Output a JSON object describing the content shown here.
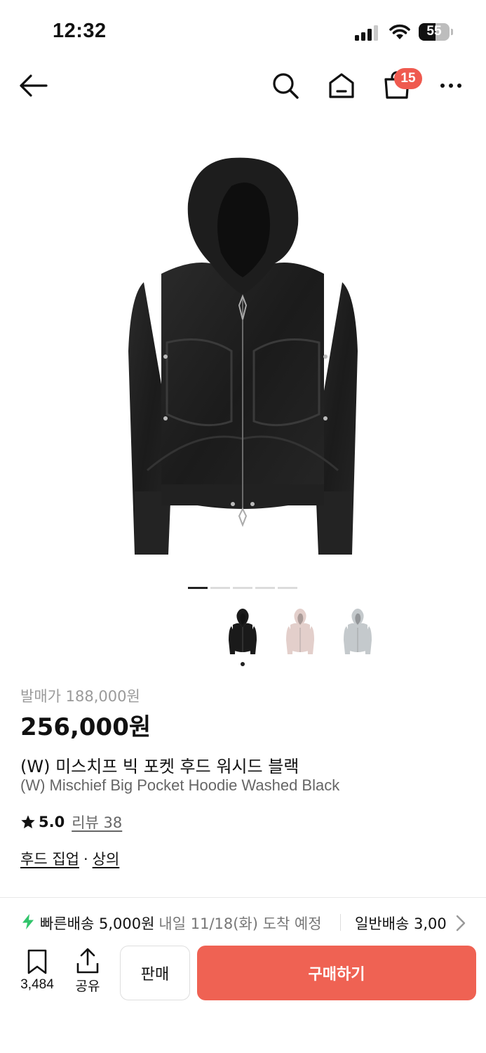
{
  "status_bar": {
    "time": "12:32",
    "battery": "55",
    "battery_level": 0.55
  },
  "nav": {
    "cart_count": "15"
  },
  "gallery": {
    "page_count": 5,
    "active_page": 0,
    "thumbnails": [
      {
        "color": "#1a1a1a",
        "name": "black"
      },
      {
        "color": "#e3cfcb",
        "name": "pink"
      },
      {
        "color": "#c4c9cc",
        "name": "gray"
      }
    ],
    "selected_thumbnail": 0
  },
  "product": {
    "release_price": "발매가 188,000원",
    "price": "256,000원",
    "name_ko": "(W) 미스치프 빅 포켓 후드 워시드 블랙",
    "name_en": "(W) Mischief Big Pocket Hoodie Washed Black",
    "rating": "5.0",
    "review_label": "리뷰 38",
    "category_1": "후드 집업",
    "category_sep": "·",
    "category_2": "상의"
  },
  "delivery": {
    "fast_label": "빠른배송 5,000원",
    "fast_eta": "내일 11/18(화) 도착 예정",
    "normal_label": "일반배송 3,00"
  },
  "bottom_bar": {
    "bookmark_count": "3,484",
    "share_label": "공유",
    "sell_label": "판매",
    "buy_label": "구매하기"
  },
  "colors": {
    "accent": "#ef6253",
    "badge": "#ef5a4f",
    "bolt": "#31c46b"
  }
}
